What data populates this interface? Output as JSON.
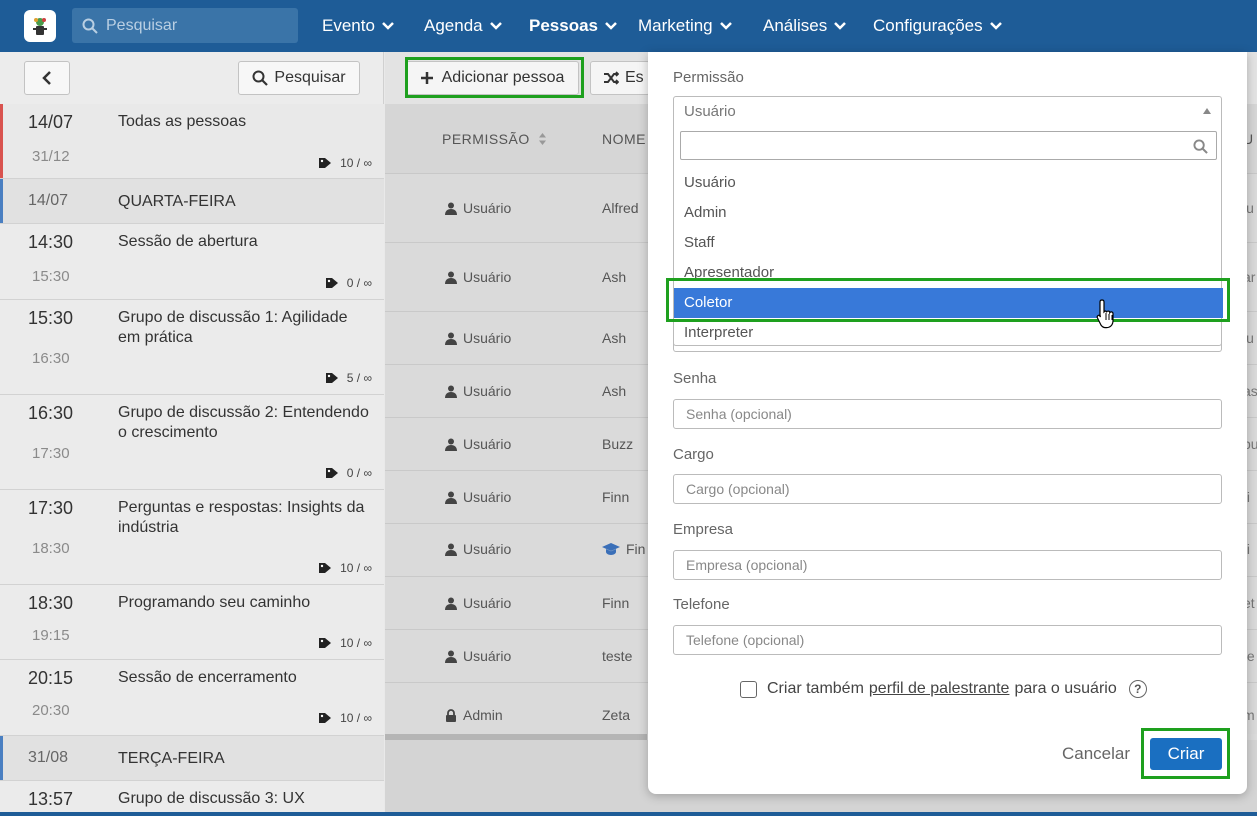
{
  "topbar": {
    "search_placeholder": "Pesquisar",
    "nav": [
      {
        "label": "Evento"
      },
      {
        "label": "Agenda"
      },
      {
        "label": "Pessoas"
      },
      {
        "label": "Marketing"
      },
      {
        "label": "Análises"
      },
      {
        "label": "Configurações"
      }
    ],
    "active_nav": "Pessoas",
    "color": "#1e5c97"
  },
  "sidebar": {
    "search_label": "Pesquisar",
    "sessions": [
      {
        "start": "14/07",
        "end": "31/12",
        "title": "Todas as pessoas",
        "tag": "10 / ∞"
      },
      {
        "start": "14/07",
        "title": "QUARTA-FEIRA"
      },
      {
        "start": "14:30",
        "end": "15:30",
        "title": "Sessão de abertura",
        "tag": "0 / ∞"
      },
      {
        "start": "15:30",
        "end": "16:30",
        "title": "Grupo de discussão 1: Agilidade em prática",
        "tag": "5 / ∞"
      },
      {
        "start": "16:30",
        "end": "17:30",
        "title": "Grupo de discussão 2: Entendendo o crescimento",
        "tag": "0 / ∞"
      },
      {
        "start": "17:30",
        "end": "18:30",
        "title": "Perguntas e respostas: Insights da indústria",
        "tag": "10 / ∞"
      },
      {
        "start": "18:30",
        "end": "19:15",
        "title": "Programando seu caminho",
        "tag": "10 / ∞"
      },
      {
        "start": "20:15",
        "end": "20:30",
        "title": "Sessão de encerramento",
        "tag": "10 / ∞"
      },
      {
        "start": "31/08",
        "title": "TERÇA-FEIRA"
      },
      {
        "start": "13:57",
        "title": "Grupo de discussão 3: UX"
      }
    ]
  },
  "toolbar": {
    "add_label": "Adicionar pessoa",
    "shuffle_label": "Es"
  },
  "table": {
    "headers": {
      "permission": "PERMISSÃO",
      "name": "NOME",
      "edge": "U"
    },
    "rows": [
      {
        "permission": "Usuário",
        "name": "Alfred",
        "edge": "lu",
        "icon": "user-icon"
      },
      {
        "permission": "Usuário",
        "name": "Ash",
        "edge": "ar",
        "icon": "user-icon"
      },
      {
        "permission": "Usuário",
        "name": "Ash",
        "edge": "lu",
        "icon": "user-icon"
      },
      {
        "permission": "Usuário",
        "name": "Ash",
        "edge": "as",
        "icon": "user-icon"
      },
      {
        "permission": "Usuário",
        "name": "Buzz",
        "edge": "bu",
        "icon": "user-icon"
      },
      {
        "permission": "Usuário",
        "name": "Finn",
        "edge": "fi",
        "icon": "user-icon"
      },
      {
        "permission": "Usuário",
        "name": "Fin",
        "edge": "fi",
        "icon": "user-icon",
        "name_icon": "graduation-cap-icon"
      },
      {
        "permission": "Usuário",
        "name": "Finn",
        "edge": "et",
        "icon": "user-icon"
      },
      {
        "permission": "Usuário",
        "name": "teste",
        "edge": "te",
        "icon": "user-icon"
      },
      {
        "permission": "Admin",
        "name": "Zeta",
        "edge": "m",
        "icon": "lock-icon"
      }
    ]
  },
  "modal": {
    "permission_label": "Permissão",
    "permission_value": "Usuário",
    "options": [
      "Usuário",
      "Admin",
      "Staff",
      "Apresentador",
      "Coletor",
      "Interpreter"
    ],
    "highlighted_option": "Coletor",
    "password_label": "Senha",
    "password_placeholder": "Senha (opcional)",
    "role_label": "Cargo",
    "role_placeholder": "Cargo (opcional)",
    "company_label": "Empresa",
    "company_placeholder": "Empresa (opcional)",
    "phone_label": "Telefone",
    "phone_placeholder": "Telefone (opcional)",
    "checkbox_prefix": "Criar também",
    "checkbox_link": "perfil de palestrante",
    "checkbox_suffix": "para o usuário",
    "help": "?",
    "cancel_label": "Cancelar",
    "create_label": "Criar"
  },
  "colors": {
    "highlight": "#1ea01e",
    "primary": "#1a6fc1",
    "selected_option": "#3879d9"
  }
}
